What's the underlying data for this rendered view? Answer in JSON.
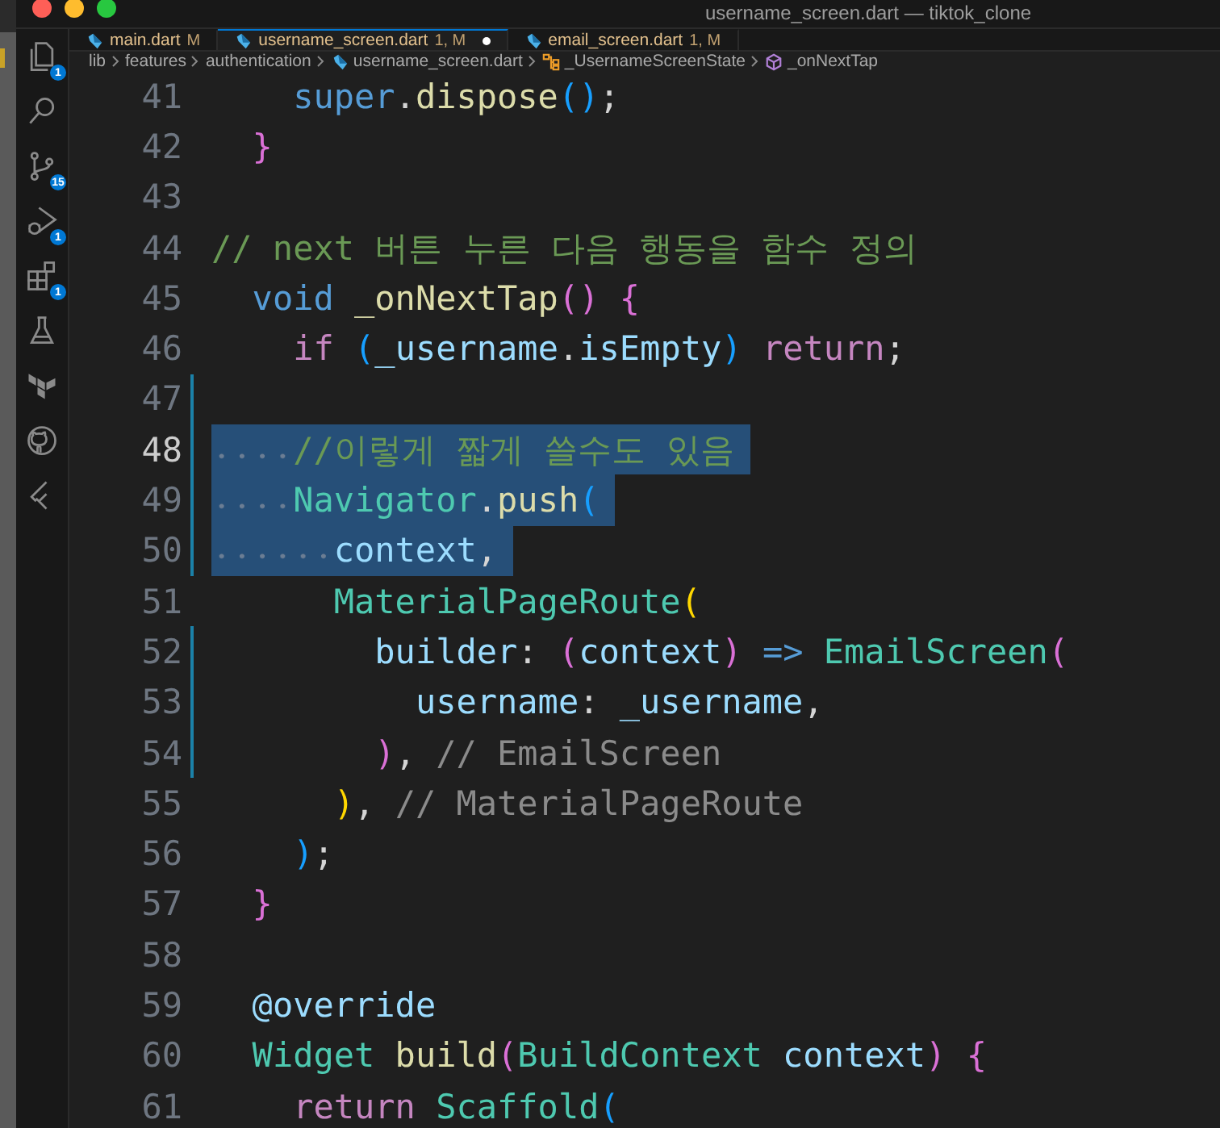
{
  "window": {
    "title": "username_screen.dart — tiktok_clone"
  },
  "activity_bar": {
    "items": [
      {
        "kind": "explorer",
        "badge": "1",
        "selected": false
      },
      {
        "kind": "search",
        "selected": false
      },
      {
        "kind": "source-control",
        "badge": "15",
        "selected": false
      },
      {
        "kind": "run-debug",
        "badge": "1",
        "selected": false
      },
      {
        "kind": "extensions",
        "badge": "1",
        "selected": false
      },
      {
        "kind": "testing",
        "selected": false
      },
      {
        "kind": "terraform",
        "selected": false
      },
      {
        "kind": "github",
        "selected": false
      },
      {
        "kind": "flutter",
        "selected": false
      }
    ]
  },
  "tabs": [
    {
      "label": "main.dart",
      "decoration": "M",
      "selected": false,
      "dirty": false
    },
    {
      "label": "username_screen.dart",
      "decoration": "1, M",
      "selected": true,
      "dirty": true
    },
    {
      "label": "email_screen.dart",
      "decoration": "1, M",
      "selected": false,
      "dirty": false
    }
  ],
  "breadcrumb": [
    {
      "label": "lib",
      "kind": "folder"
    },
    {
      "label": "features",
      "kind": "folder"
    },
    {
      "label": "authentication",
      "kind": "folder"
    },
    {
      "label": "username_screen.dart",
      "kind": "file"
    },
    {
      "label": "_UsernameScreenState",
      "kind": "class"
    },
    {
      "label": "_onNextTap",
      "kind": "method"
    }
  ],
  "editor": {
    "lines": [
      {
        "number": "41",
        "current": false,
        "selected": false,
        "modified": false,
        "tokens": [
          {
            "text": "    super",
            "kind": "keyword"
          },
          {
            "text": ".",
            "kind": "punct"
          },
          {
            "text": "dispose",
            "kind": "function"
          },
          {
            "text": "()",
            "kind": "bracket3"
          },
          {
            "text": ";",
            "kind": "punct"
          }
        ]
      },
      {
        "number": "42",
        "current": false,
        "selected": false,
        "modified": false,
        "tokens": [
          {
            "text": "  }",
            "kind": "bracket2"
          }
        ]
      },
      {
        "number": "43",
        "current": false,
        "selected": false,
        "modified": false
      },
      {
        "number": "44",
        "current": false,
        "selected": false,
        "modified": false,
        "tokens": [
          {
            "text": "// next 버튼 누른 다음 행동을 함수 정의",
            "kind": "comment"
          }
        ]
      },
      {
        "number": "45",
        "current": false,
        "selected": false,
        "modified": false,
        "tokens": [
          {
            "text": "  void",
            "kind": "keyword"
          },
          {
            "text": " _onNextTap",
            "kind": "function"
          },
          {
            "text": "()",
            "kind": "bracket2"
          },
          {
            "text": " {",
            "kind": "bracket2"
          }
        ]
      },
      {
        "number": "46",
        "current": false,
        "selected": false,
        "modified": false,
        "tokens": [
          {
            "text": "    if",
            "kind": "control"
          },
          {
            "text": " (",
            "kind": "bracket3"
          },
          {
            "text": "_username",
            "kind": "variable"
          },
          {
            "text": ".",
            "kind": "punct"
          },
          {
            "text": "isEmpty",
            "kind": "variable"
          },
          {
            "text": ")",
            "kind": "bracket3"
          },
          {
            "text": " return",
            "kind": "control"
          },
          {
            "text": ";",
            "kind": "punct"
          }
        ]
      },
      {
        "number": "47",
        "current": false,
        "selected": false,
        "modified": true
      },
      {
        "number": "48",
        "current": true,
        "selected": true,
        "modified": true,
        "tokens": [
          {
            "text": "    //이렇게 짧게 쓸수도 있음",
            "kind": "comment"
          }
        ]
      },
      {
        "number": "49",
        "current": false,
        "selected": true,
        "modified": true,
        "tokens": [
          {
            "text": "    Navigator",
            "kind": "type"
          },
          {
            "text": ".",
            "kind": "punct"
          },
          {
            "text": "push",
            "kind": "function"
          },
          {
            "text": "(",
            "kind": "bracket3"
          }
        ]
      },
      {
        "number": "50",
        "current": false,
        "selected": true,
        "modified": true,
        "tokens": [
          {
            "text": "      context",
            "kind": "variable"
          },
          {
            "text": ",",
            "kind": "punct"
          }
        ]
      },
      {
        "number": "51",
        "current": false,
        "selected": false,
        "modified": false,
        "tokens": [
          {
            "text": "      MaterialPageRoute",
            "kind": "type"
          },
          {
            "text": "(",
            "kind": "bracket1"
          }
        ]
      },
      {
        "number": "52",
        "current": false,
        "selected": false,
        "modified": true,
        "tokens": [
          {
            "text": "        builder",
            "kind": "variable"
          },
          {
            "text": ": ",
            "kind": "punct"
          },
          {
            "text": "(",
            "kind": "bracket2"
          },
          {
            "text": "context",
            "kind": "variable"
          },
          {
            "text": ")",
            "kind": "bracket2"
          },
          {
            "text": " =>",
            "kind": "keyword"
          },
          {
            "text": " EmailScreen",
            "kind": "type"
          },
          {
            "text": "(",
            "kind": "bracket2"
          }
        ]
      },
      {
        "number": "53",
        "current": false,
        "selected": false,
        "modified": true,
        "tokens": [
          {
            "text": "          username",
            "kind": "variable"
          },
          {
            "text": ": ",
            "kind": "punct"
          },
          {
            "text": "_username",
            "kind": "variable"
          },
          {
            "text": ",",
            "kind": "punct"
          }
        ]
      },
      {
        "number": "54",
        "current": false,
        "selected": false,
        "modified": true,
        "tokens": [
          {
            "text": "        )",
            "kind": "bracket2"
          },
          {
            "text": ",",
            "kind": "punct"
          },
          {
            "text": " // EmailScreen",
            "kind": "label"
          }
        ]
      },
      {
        "number": "55",
        "current": false,
        "selected": false,
        "modified": false,
        "tokens": [
          {
            "text": "      )",
            "kind": "bracket1"
          },
          {
            "text": ",",
            "kind": "punct"
          },
          {
            "text": " // MaterialPageRoute",
            "kind": "label"
          }
        ]
      },
      {
        "number": "56",
        "current": false,
        "selected": false,
        "modified": false,
        "tokens": [
          {
            "text": "    )",
            "kind": "bracket3"
          },
          {
            "text": ";",
            "kind": "punct"
          }
        ]
      },
      {
        "number": "57",
        "current": false,
        "selected": false,
        "modified": false,
        "tokens": [
          {
            "text": "  }",
            "kind": "bracket2"
          }
        ]
      },
      {
        "number": "58",
        "current": false,
        "selected": false,
        "modified": false
      },
      {
        "number": "59",
        "current": false,
        "selected": false,
        "modified": false,
        "tokens": [
          {
            "text": "  @override",
            "kind": "variable"
          }
        ]
      },
      {
        "number": "60",
        "current": false,
        "selected": false,
        "modified": false,
        "tokens": [
          {
            "text": "  Widget",
            "kind": "type"
          },
          {
            "text": " build",
            "kind": "function"
          },
          {
            "text": "(",
            "kind": "bracket2"
          },
          {
            "text": "BuildContext",
            "kind": "type"
          },
          {
            "text": " context",
            "kind": "variable"
          },
          {
            "text": ")",
            "kind": "bracket2"
          },
          {
            "text": " {",
            "kind": "bracket2"
          }
        ]
      },
      {
        "number": "61",
        "current": false,
        "selected": false,
        "modified": false,
        "tokens": [
          {
            "text": "    return",
            "kind": "control"
          },
          {
            "text": " Scaffold",
            "kind": "type"
          },
          {
            "text": "(",
            "kind": "bracket3"
          }
        ]
      }
    ]
  }
}
